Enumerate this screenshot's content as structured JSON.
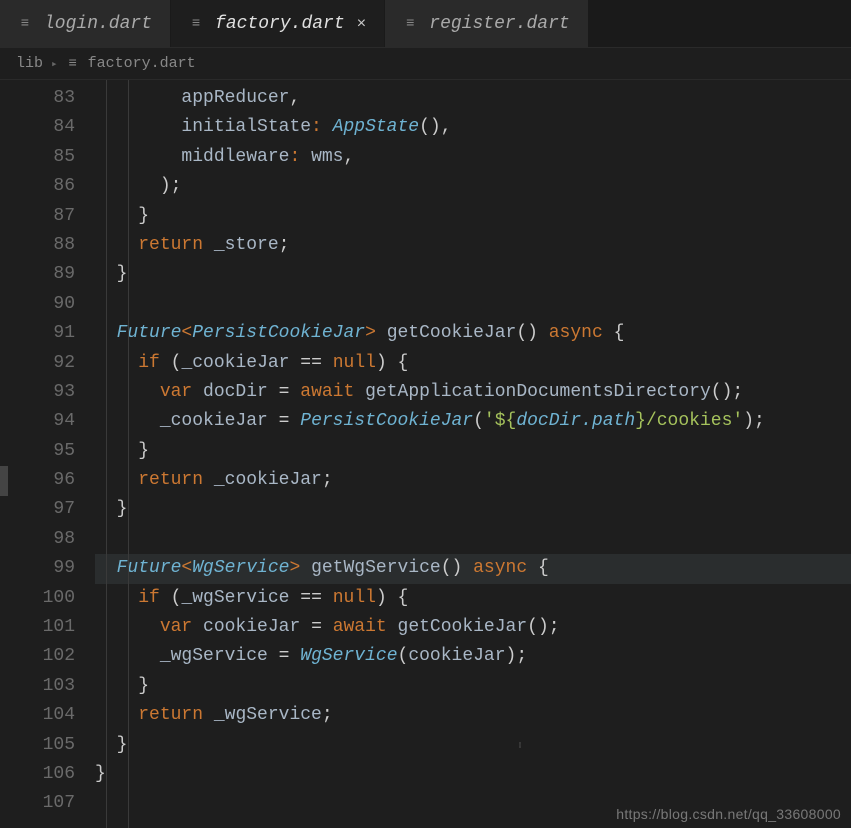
{
  "tabs": [
    {
      "label": "login.dart",
      "active": false,
      "dirty": false
    },
    {
      "label": "factory.dart",
      "active": true,
      "dirty": true
    },
    {
      "label": "register.dart",
      "active": false,
      "dirty": false
    }
  ],
  "breadcrumbs": {
    "folder": "lib",
    "file": "factory.dart"
  },
  "line_numbers": [
    "83",
    "84",
    "85",
    "86",
    "87",
    "88",
    "89",
    "90",
    "91",
    "92",
    "93",
    "94",
    "95",
    "96",
    "97",
    "98",
    "99",
    "100",
    "101",
    "102",
    "103",
    "104",
    "105",
    "106",
    "107"
  ],
  "current_line": "99",
  "code": {
    "l83": {
      "text": "appReducer",
      "tail": ","
    },
    "l84": {
      "name": "initialState",
      "type": "AppState",
      "tail": "(),"
    },
    "l85": {
      "name": "middleware",
      "value": "wms",
      "tail": ","
    },
    "l86": {
      "text": ");"
    },
    "l87": {
      "text": "}"
    },
    "l88": {
      "kw": "return",
      "id": "_store",
      "tail": ";"
    },
    "l89": {
      "text": "}"
    },
    "l91": {
      "ret": "Future",
      "gen": "PersistCookieJar",
      "fn": "getCookieJar",
      "async": "async"
    },
    "l92": {
      "kw": "if",
      "lhs": "_cookieJar",
      "op": "==",
      "rhs": "null"
    },
    "l93": {
      "kw": "var",
      "id": "docDir",
      "aw": "await",
      "call": "getApplicationDocumentsDirectory",
      "tail": "();"
    },
    "l94": {
      "lhs": "_cookieJar",
      "type": "PersistCookieJar",
      "str_pre": "'${",
      "interp": "docDir.path",
      "str_post": "}/cookies'",
      "tail": ");"
    },
    "l95": {
      "text": "}"
    },
    "l96": {
      "kw": "return",
      "id": "_cookieJar",
      "tail": ";"
    },
    "l97": {
      "text": "}"
    },
    "l99": {
      "ret": "Future",
      "gen": "WgService",
      "fn": "getWgService",
      "async": "async"
    },
    "l100": {
      "kw": "if",
      "lhs": "_wgService",
      "op": "==",
      "rhs": "null"
    },
    "l101": {
      "kw": "var",
      "id": "cookieJar",
      "aw": "await",
      "call": "getCookieJar",
      "tail": "();"
    },
    "l102": {
      "lhs": "_wgService",
      "type": "WgService",
      "arg": "cookieJar",
      "tail": ");"
    },
    "l103": {
      "text": "}"
    },
    "l104": {
      "kw": "return",
      "id": "_wgService",
      "tail": ";"
    },
    "l105": {
      "text": "}"
    },
    "l106": {
      "text": "}"
    }
  },
  "watermark": "https://blog.csdn.net/qq_33608000"
}
